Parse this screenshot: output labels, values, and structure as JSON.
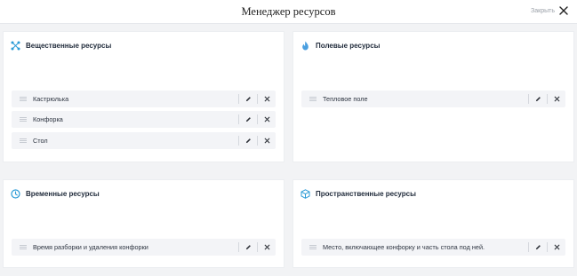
{
  "header": {
    "title": "Менеджер ресурсов",
    "close_label": "Закрыть"
  },
  "cards": {
    "material": {
      "title": "Вещественные ресурсы",
      "items": [
        "Кастрюлька",
        "Конфорка",
        "Стол"
      ]
    },
    "field": {
      "title": "Полевые ресурсы",
      "items": [
        "Тепловое поле"
      ]
    },
    "temporal": {
      "title": "Временные ресурсы",
      "items": [
        "Время разборки и удаления конфорки"
      ]
    },
    "spatial": {
      "title": "Пространственные ресурсы",
      "items": [
        "Место, включающее конфорку и часть стола под ней."
      ]
    }
  },
  "colors": {
    "accent": "#2b9bd6",
    "flame": "#4a9fe0",
    "row_bg": "#f3f4f7"
  },
  "icons": [
    "close-icon",
    "molecule-icon",
    "flame-icon",
    "clock-icon",
    "cube-icon",
    "drag-handle-icon",
    "pencil-icon",
    "delete-icon"
  ]
}
